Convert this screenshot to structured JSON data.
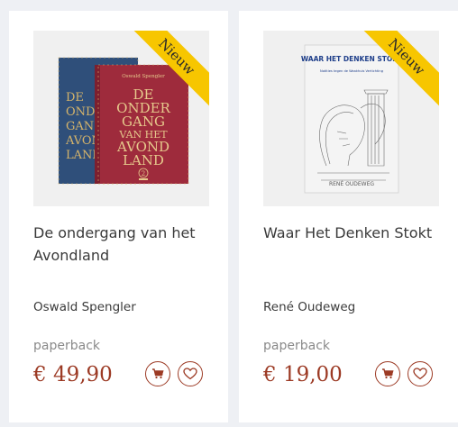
{
  "products": [
    {
      "badge": "Nieuw",
      "title": "De ondergang van het Avondland",
      "author": "Oswald Spengler",
      "format": "paperback",
      "price": "€ 49,90",
      "cover": {
        "author_line": "Oswald Spengler",
        "title_lines": [
          "DE",
          "ONDER",
          "GANG",
          "VAN HET",
          "AVOND",
          "LAND"
        ],
        "volume": "2",
        "colors": {
          "front": "#9e2b3c",
          "back": "#2f4f7a",
          "gold": "#d6b46a"
        }
      },
      "cart_icon": "cart-icon",
      "fav_icon": "heart-icon"
    },
    {
      "badge": "Nieuw",
      "title": "Waar Het Denken Stokt",
      "author": "René Oudeweg",
      "format": "paperback",
      "price": "€ 19,00",
      "cover": {
        "title": "WAAR HET DENKEN STOKT",
        "subtitle": "Notities tegen de Waakhuis Vertichting",
        "author": "RENÉ OUDEWEG"
      },
      "cart_icon": "cart-icon",
      "fav_icon": "heart-icon"
    }
  ],
  "colors": {
    "accent": "#9c3a24",
    "badge": "#f7c600",
    "background": "#eef0f4"
  }
}
